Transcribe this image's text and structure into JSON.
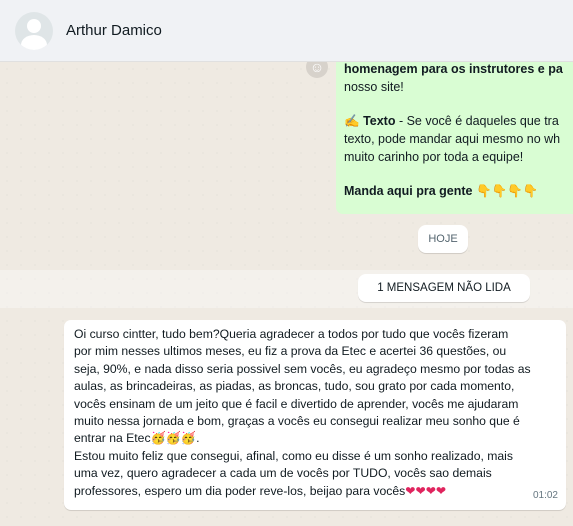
{
  "contact": {
    "name": "Arthur Damico"
  },
  "outgoing": {
    "line1": "homenagem para os instrutores e pa",
    "line2": "nosso site!",
    "texto_emoji": "✍️",
    "texto_label": "Texto",
    "texto_line1": " - Se você é daqueles que tra",
    "texto_line2": "texto, pode mandar aqui mesmo no wh",
    "texto_line3": "muito carinho por toda a equipe!",
    "cta": "Manda aqui pra gente",
    "cta_emoji": "👇👇👇👇"
  },
  "dividers": {
    "today": "HOJE",
    "unread": "1 MENSAGEM NÃO LIDA"
  },
  "incoming": {
    "text": "Oi curso cintter, tudo bem?Queria agradecer a todos por tudo que vocês fizeram\npor mim nesses ultimos meses, eu fiz a prova da Etec e acertei 36 questões, ou\nseja, 90%, e nada disso seria possivel sem vocês, eu agradeço mesmo por todas as\naulas, as brincadeiras, as piadas, as broncas, tudo, sou grato por cada momento,\nvocês ensinam de um jeito que é facil e divertido de aprender, vocês me ajudaram\nmuito nessa jornada e bom, graças a vocês eu consegui realizar meu sonho que é\nentrar na Etec🥳🥳🥳.\nEstou muito feliz que consegui, afinal, como eu disse é um sonho realizado, mais\numa vez, quero agradecer a cada um de vocês por TUDO, vocês sao demais\nprofessores, espero um dia poder reve-los, beijao para vocês",
    "hearts": "❤❤❤❤",
    "time": "01:02"
  }
}
